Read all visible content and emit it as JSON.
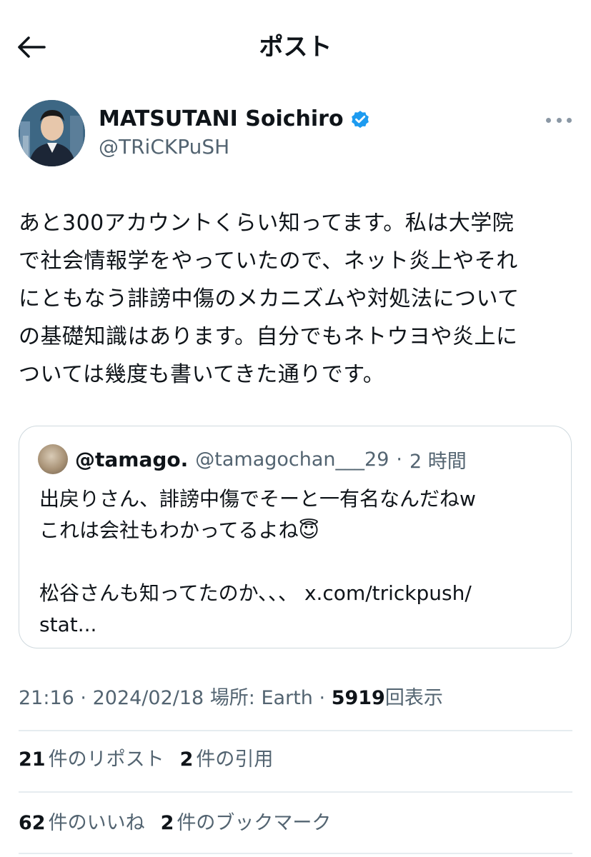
{
  "header": {
    "title": "ポスト"
  },
  "author": {
    "display_name": "MATSUTANI Soichiro",
    "handle": "@TRiCKPuSH"
  },
  "post": {
    "text": "あと300アカウントくらい知ってます。私は大学院\nで社会情報学をやっていたので、ネット炎上やそれ\nにともなう誹謗中傷のメカニズムや対処法について\nの基礎知識はあります。自分でもネトウヨや炎上に\nついては幾度も書いてきた通りです。"
  },
  "quote": {
    "display_name": "@tamago.",
    "handle": "@tamagochan___29",
    "separator": "·",
    "time": "2 時間",
    "text": "出戻りさん、誹謗中傷でそーと一有名なんだねw\nこれは会社もわかってるよね😇\n\n松谷さんも知ってたのか、、、 x.com/trickpush/\nstat..."
  },
  "meta": {
    "time": "21:16",
    "separator": "·",
    "date": "2024/02/18",
    "location": "場所: Earth",
    "views_count": "5919",
    "views_label": "回表示"
  },
  "stats": {
    "reposts_count": "21",
    "reposts_label": "件のリポスト",
    "quotes_count": "2",
    "quotes_label": "件の引用",
    "likes_count": "62",
    "likes_label": "件のいいね",
    "bookmarks_count": "2",
    "bookmarks_label": "件のブックマーク"
  },
  "colors": {
    "text": "#0f1419",
    "secondary": "#536471",
    "verified": "#1d9bf0",
    "border": "#cfd9de"
  }
}
